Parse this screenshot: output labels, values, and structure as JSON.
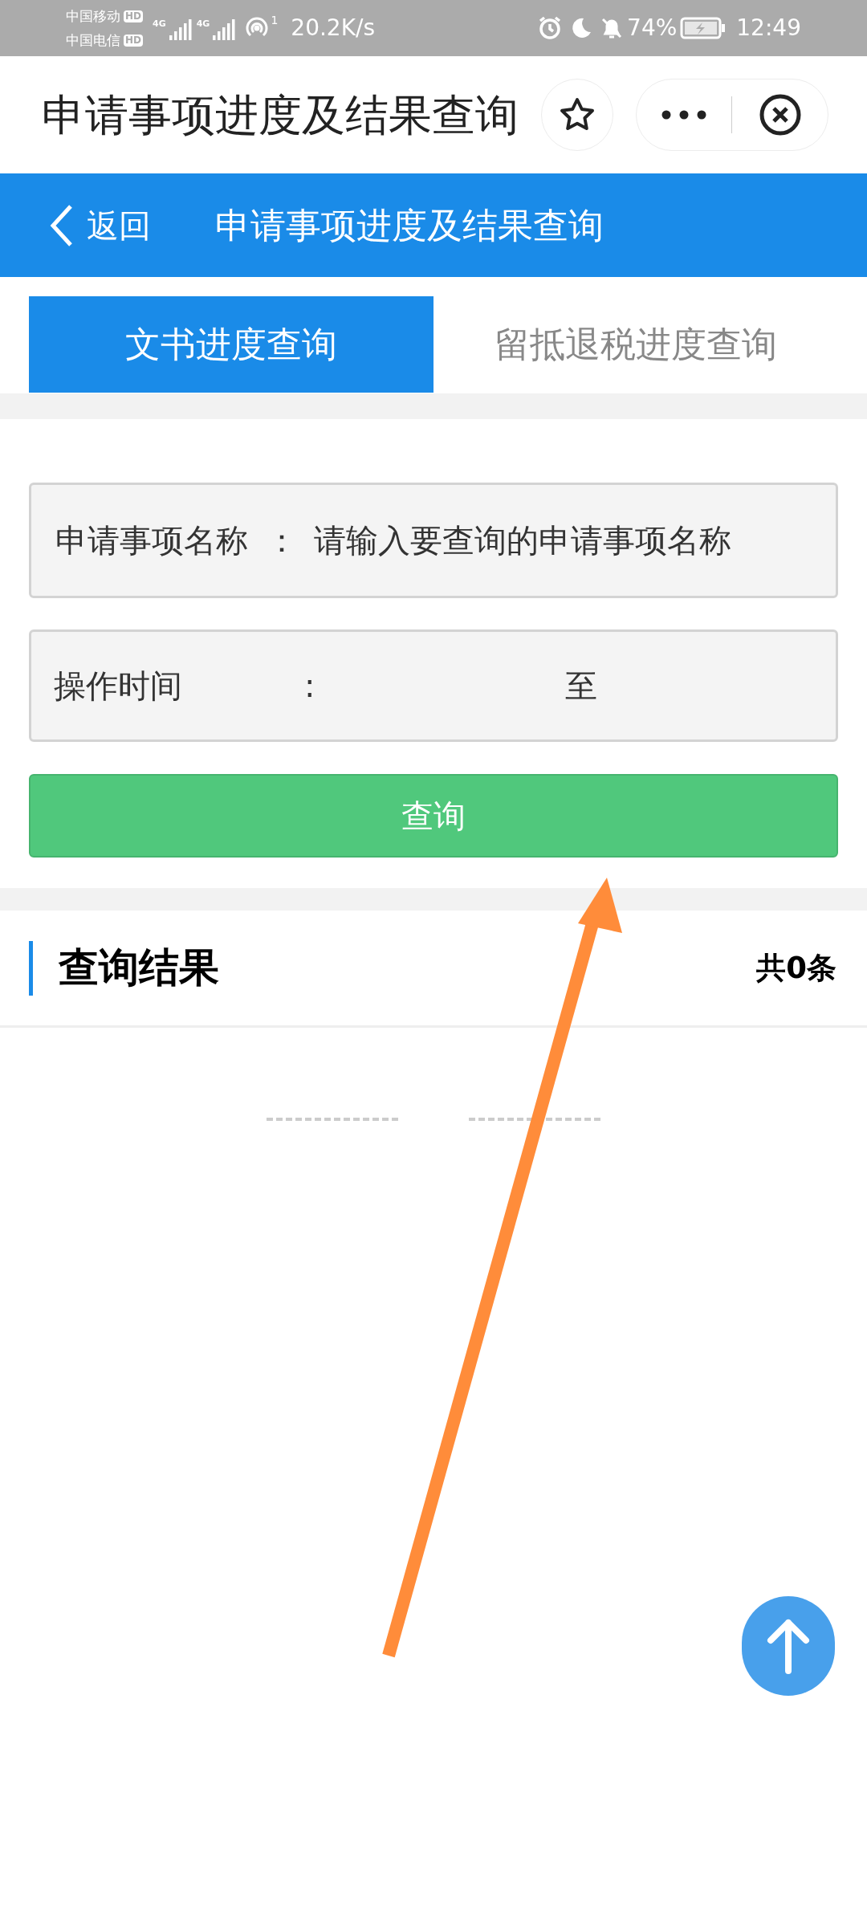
{
  "status_bar": {
    "carriers": [
      {
        "name": "中国移动",
        "badge": "HD"
      },
      {
        "name": "中国电信",
        "badge": "HD"
      }
    ],
    "signals": [
      "4G",
      "4G"
    ],
    "hotspot_count": "1",
    "speed": "20.2K/s",
    "battery": "74%",
    "time": "12:49"
  },
  "mini_header": {
    "title": "申请事项进度及结果查询"
  },
  "nav_bar": {
    "back": "返回",
    "title": "申请事项进度及结果查询"
  },
  "tabs": [
    {
      "label": "文书进度查询",
      "selected": true
    },
    {
      "label": "留抵退税进度查询",
      "selected": false
    }
  ],
  "form": {
    "fields": [
      {
        "kind": "text",
        "label": "申请事项名称",
        "separator": "：",
        "placeholder": "请输入要查询的申请事项名称"
      },
      {
        "kind": "range",
        "label": "操作时间",
        "separator": ":",
        "between": "至"
      }
    ],
    "submit": "查询"
  },
  "results": {
    "title": "查询结果",
    "count": "共0条"
  }
}
